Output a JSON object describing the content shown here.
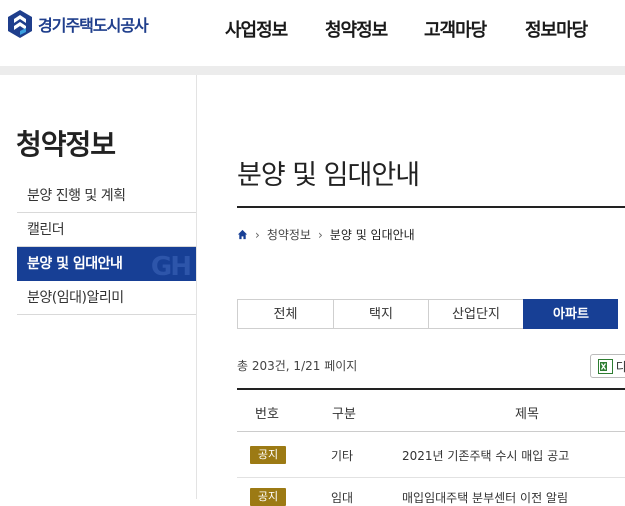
{
  "header": {
    "logo_text": "경기주택도시공사",
    "nav": [
      "사업정보",
      "청약정보",
      "고객마당",
      "정보마당"
    ]
  },
  "sidebar": {
    "title": "청약정보",
    "items": [
      {
        "label": "분양 진행 및 계획"
      },
      {
        "label": "캘린더"
      },
      {
        "label": "분양 및 임대안내"
      },
      {
        "label": "분양(임대)알리미"
      }
    ]
  },
  "main": {
    "title": "분양 및 임대안내",
    "breadcrumb": [
      "청약정보",
      "분양 및 임대안내"
    ],
    "tabs": [
      "전체",
      "택지",
      "산업단지",
      "아파트"
    ],
    "count_text": "총 203건, 1/21 페이지",
    "excel_label": "다",
    "table": {
      "headers": [
        "번호",
        "구분",
        "제목"
      ],
      "rows": [
        {
          "badge": "공지",
          "type": "기타",
          "title": "2021년 기존주택 수시 매입 공고"
        },
        {
          "badge": "공지",
          "type": "임대",
          "title": "매입임대주택 분부센터 이전 알림"
        }
      ]
    }
  },
  "colors": {
    "brand": "#1f3e8c",
    "active_nav": "#173f95",
    "badge": "#9c7a14"
  }
}
